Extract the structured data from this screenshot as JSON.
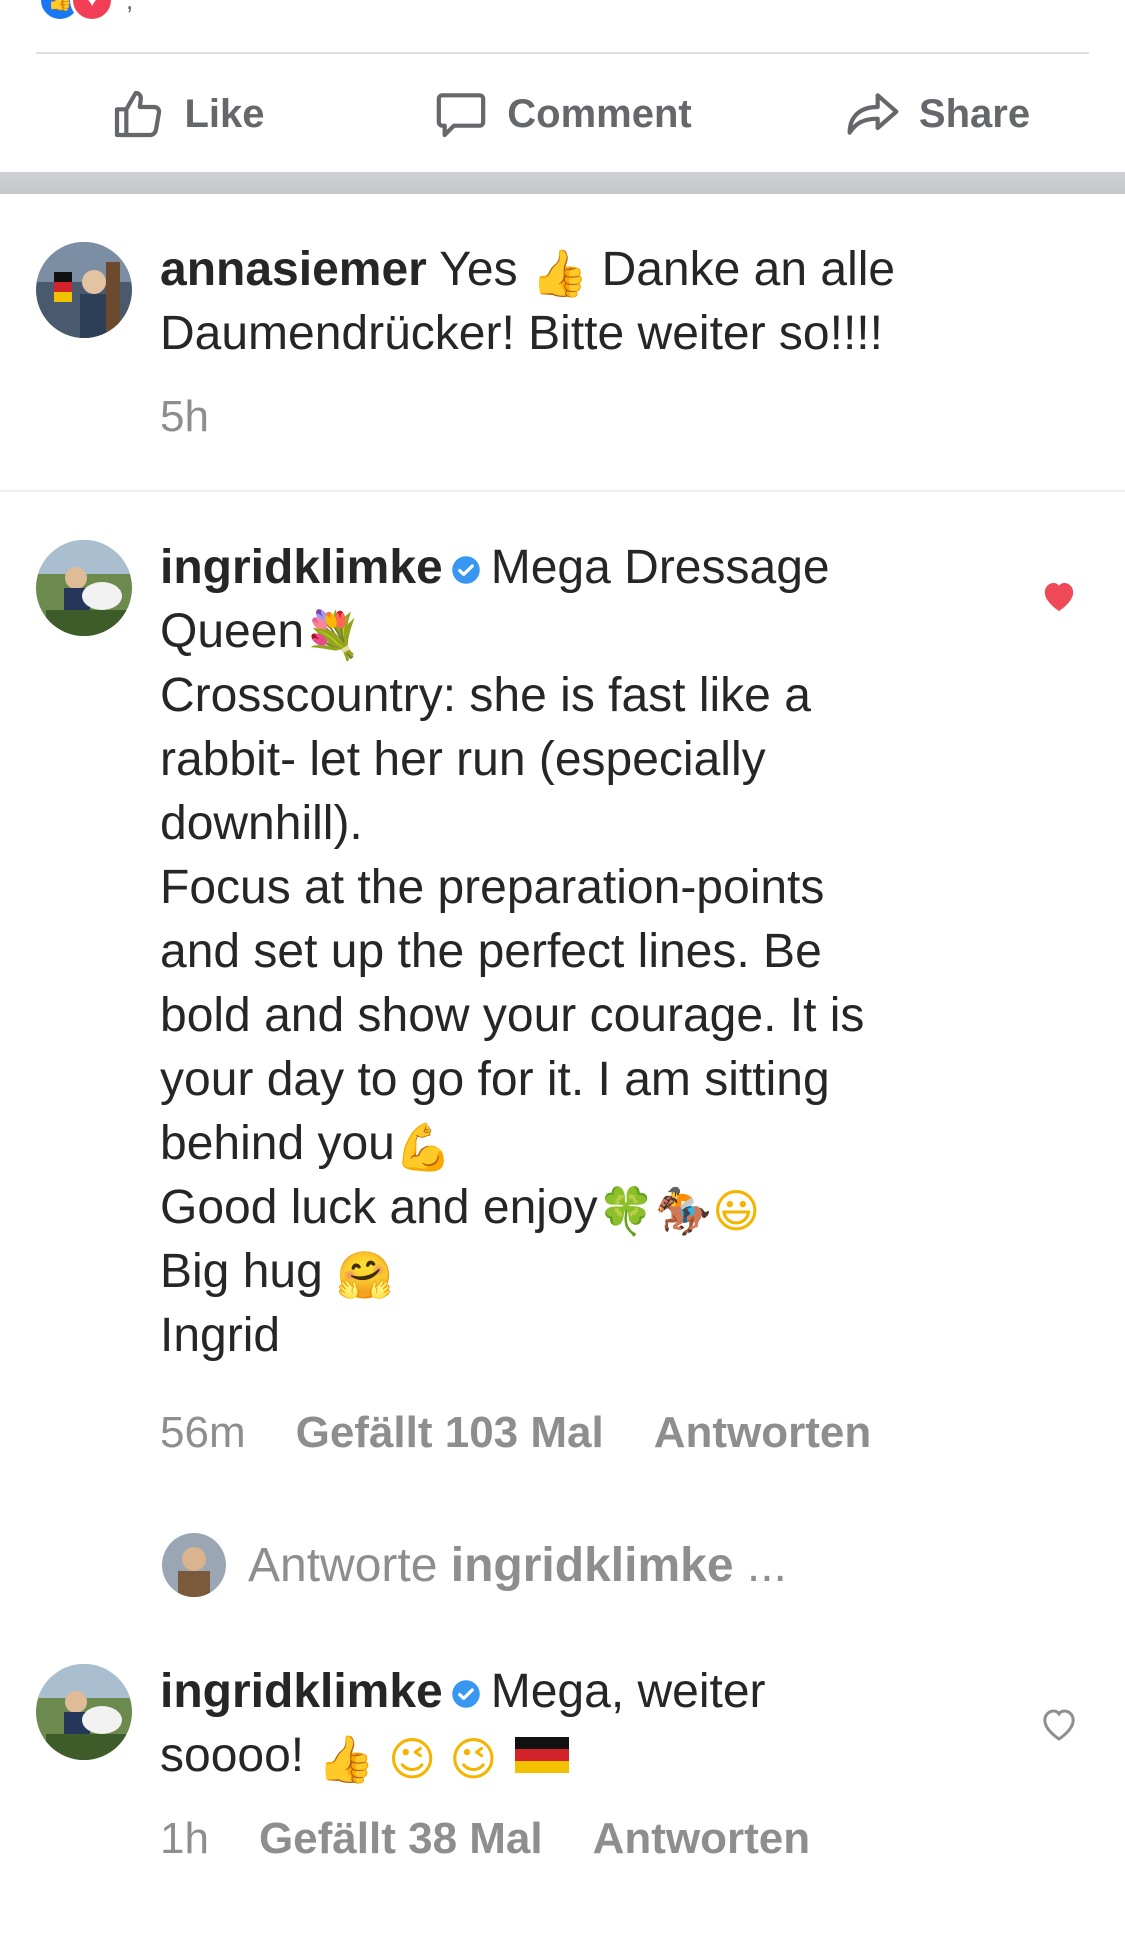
{
  "facebook": {
    "reaction_count": ",",
    "actions": [
      {
        "label": "Like",
        "icon": "thumbs-up-icon"
      },
      {
        "label": "Comment",
        "icon": "comment-bubble-icon"
      },
      {
        "label": "Share",
        "icon": "share-arrow-icon"
      }
    ]
  },
  "comments": [
    {
      "username": "annasiemer",
      "lines": [
        "Yes",
        "Danke an alle",
        "Daumendrücker! Bitte weiter so!!!!"
      ],
      "time": "5h"
    },
    {
      "username": "ingridklimke",
      "verified": true,
      "liked": true,
      "first_text": "Mega Dressage",
      "line_queen": "Queen",
      "line_cc1": "Crosscountry: she is fast like a",
      "line_cc2": "rabbit- let her run (especially",
      "line_cc3": "downhill).",
      "line_f1": "Focus at the preparation-points",
      "line_f2": "and set up the perfect lines. Be",
      "line_f3": "bold and show your courage. It is",
      "line_f4": "your day to go for it. I am sitting",
      "line_f5": "behind you",
      "line_luck": "Good luck and enjoy",
      "line_hug": "Big hug",
      "line_sign": "Ingrid",
      "time": "56m",
      "likes": "Gefällt 103 Mal",
      "reply": "Antworten"
    },
    {
      "username": "ingridklimke",
      "verified": true,
      "liked": false,
      "first_text": "Mega, weiter",
      "line2": "soooo!",
      "time": "1h",
      "likes": "Gefällt 38 Mal",
      "reply": "Antworten"
    }
  ],
  "reply_prompt": {
    "prefix": "Antworte",
    "username": "ingridklimke",
    "suffix": "..."
  },
  "colors": {
    "text": "#262626",
    "meta": "#8e8e8e",
    "heart_red": "#ed4956",
    "verified_blue": "#3897f0",
    "fb_gray": "#65676b"
  }
}
